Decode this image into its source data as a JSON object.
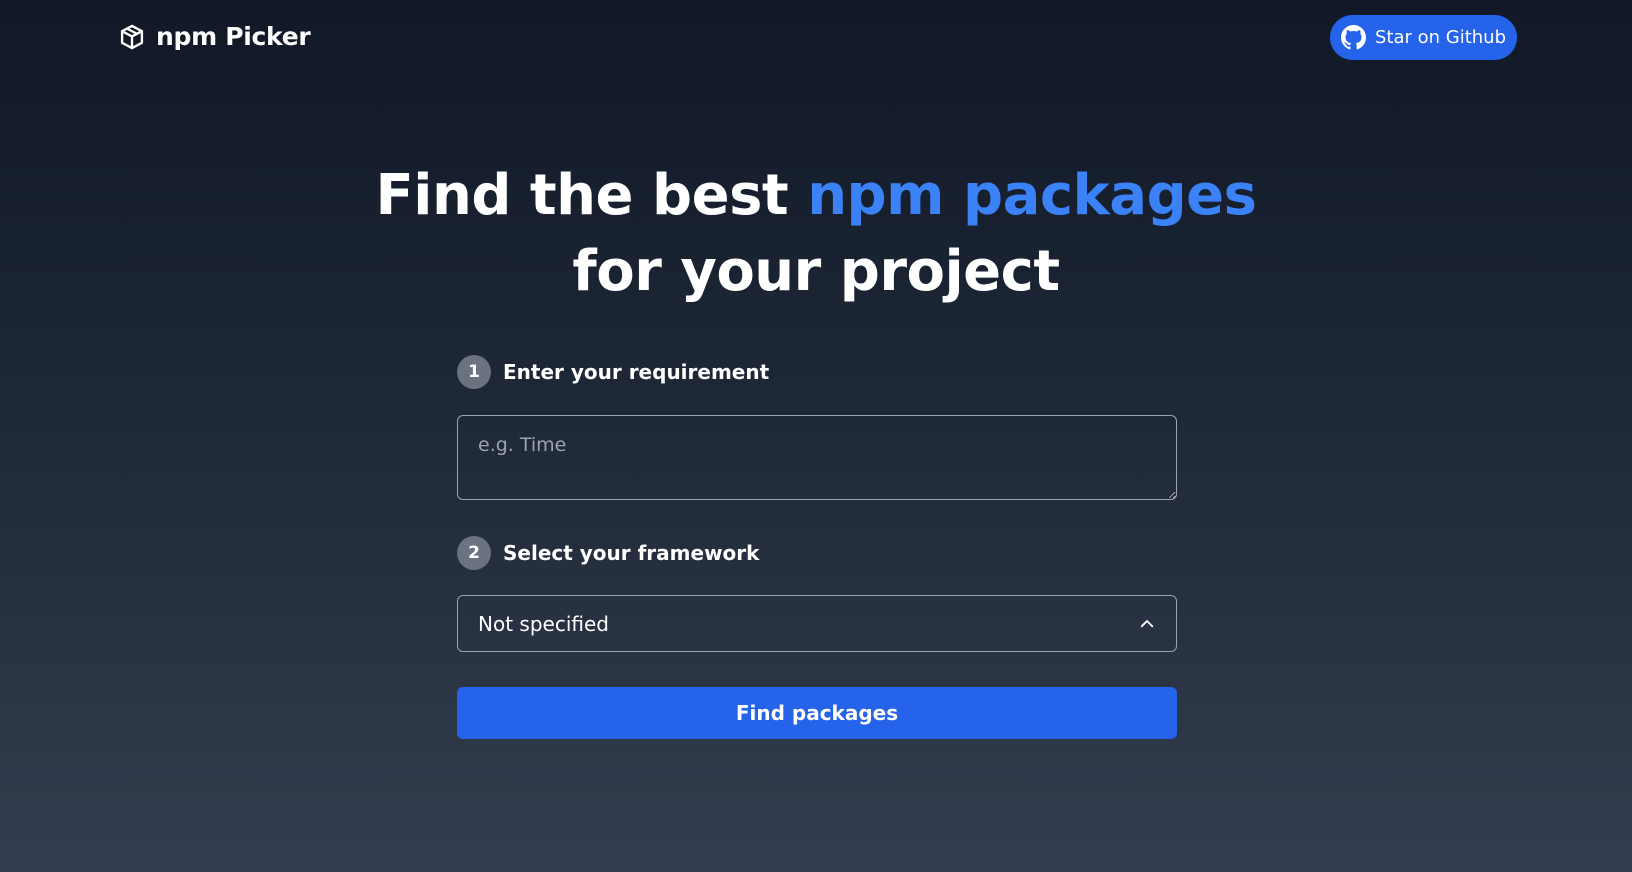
{
  "header": {
    "brand_icon": "package-cube-icon",
    "brand_name": "npm Picker",
    "github_icon": "github-icon",
    "star_label": "Star on Github"
  },
  "hero": {
    "line1_prefix": "Find the best",
    "line1_accent": "npm packages",
    "line2": "for your project"
  },
  "form": {
    "step1": {
      "number": "1",
      "label": "Enter your requirement",
      "value": "",
      "placeholder": "e.g. Time"
    },
    "step2": {
      "number": "2",
      "label": "Select your framework",
      "selected": "Not specified",
      "icon": "chevron-up-icon"
    },
    "submit_label": "Find packages"
  },
  "colors": {
    "accent": "#3b82f6",
    "button": "#2563eb",
    "badge": "#6b7280",
    "background_top": "#111827",
    "background_bottom": "#333d4f"
  }
}
